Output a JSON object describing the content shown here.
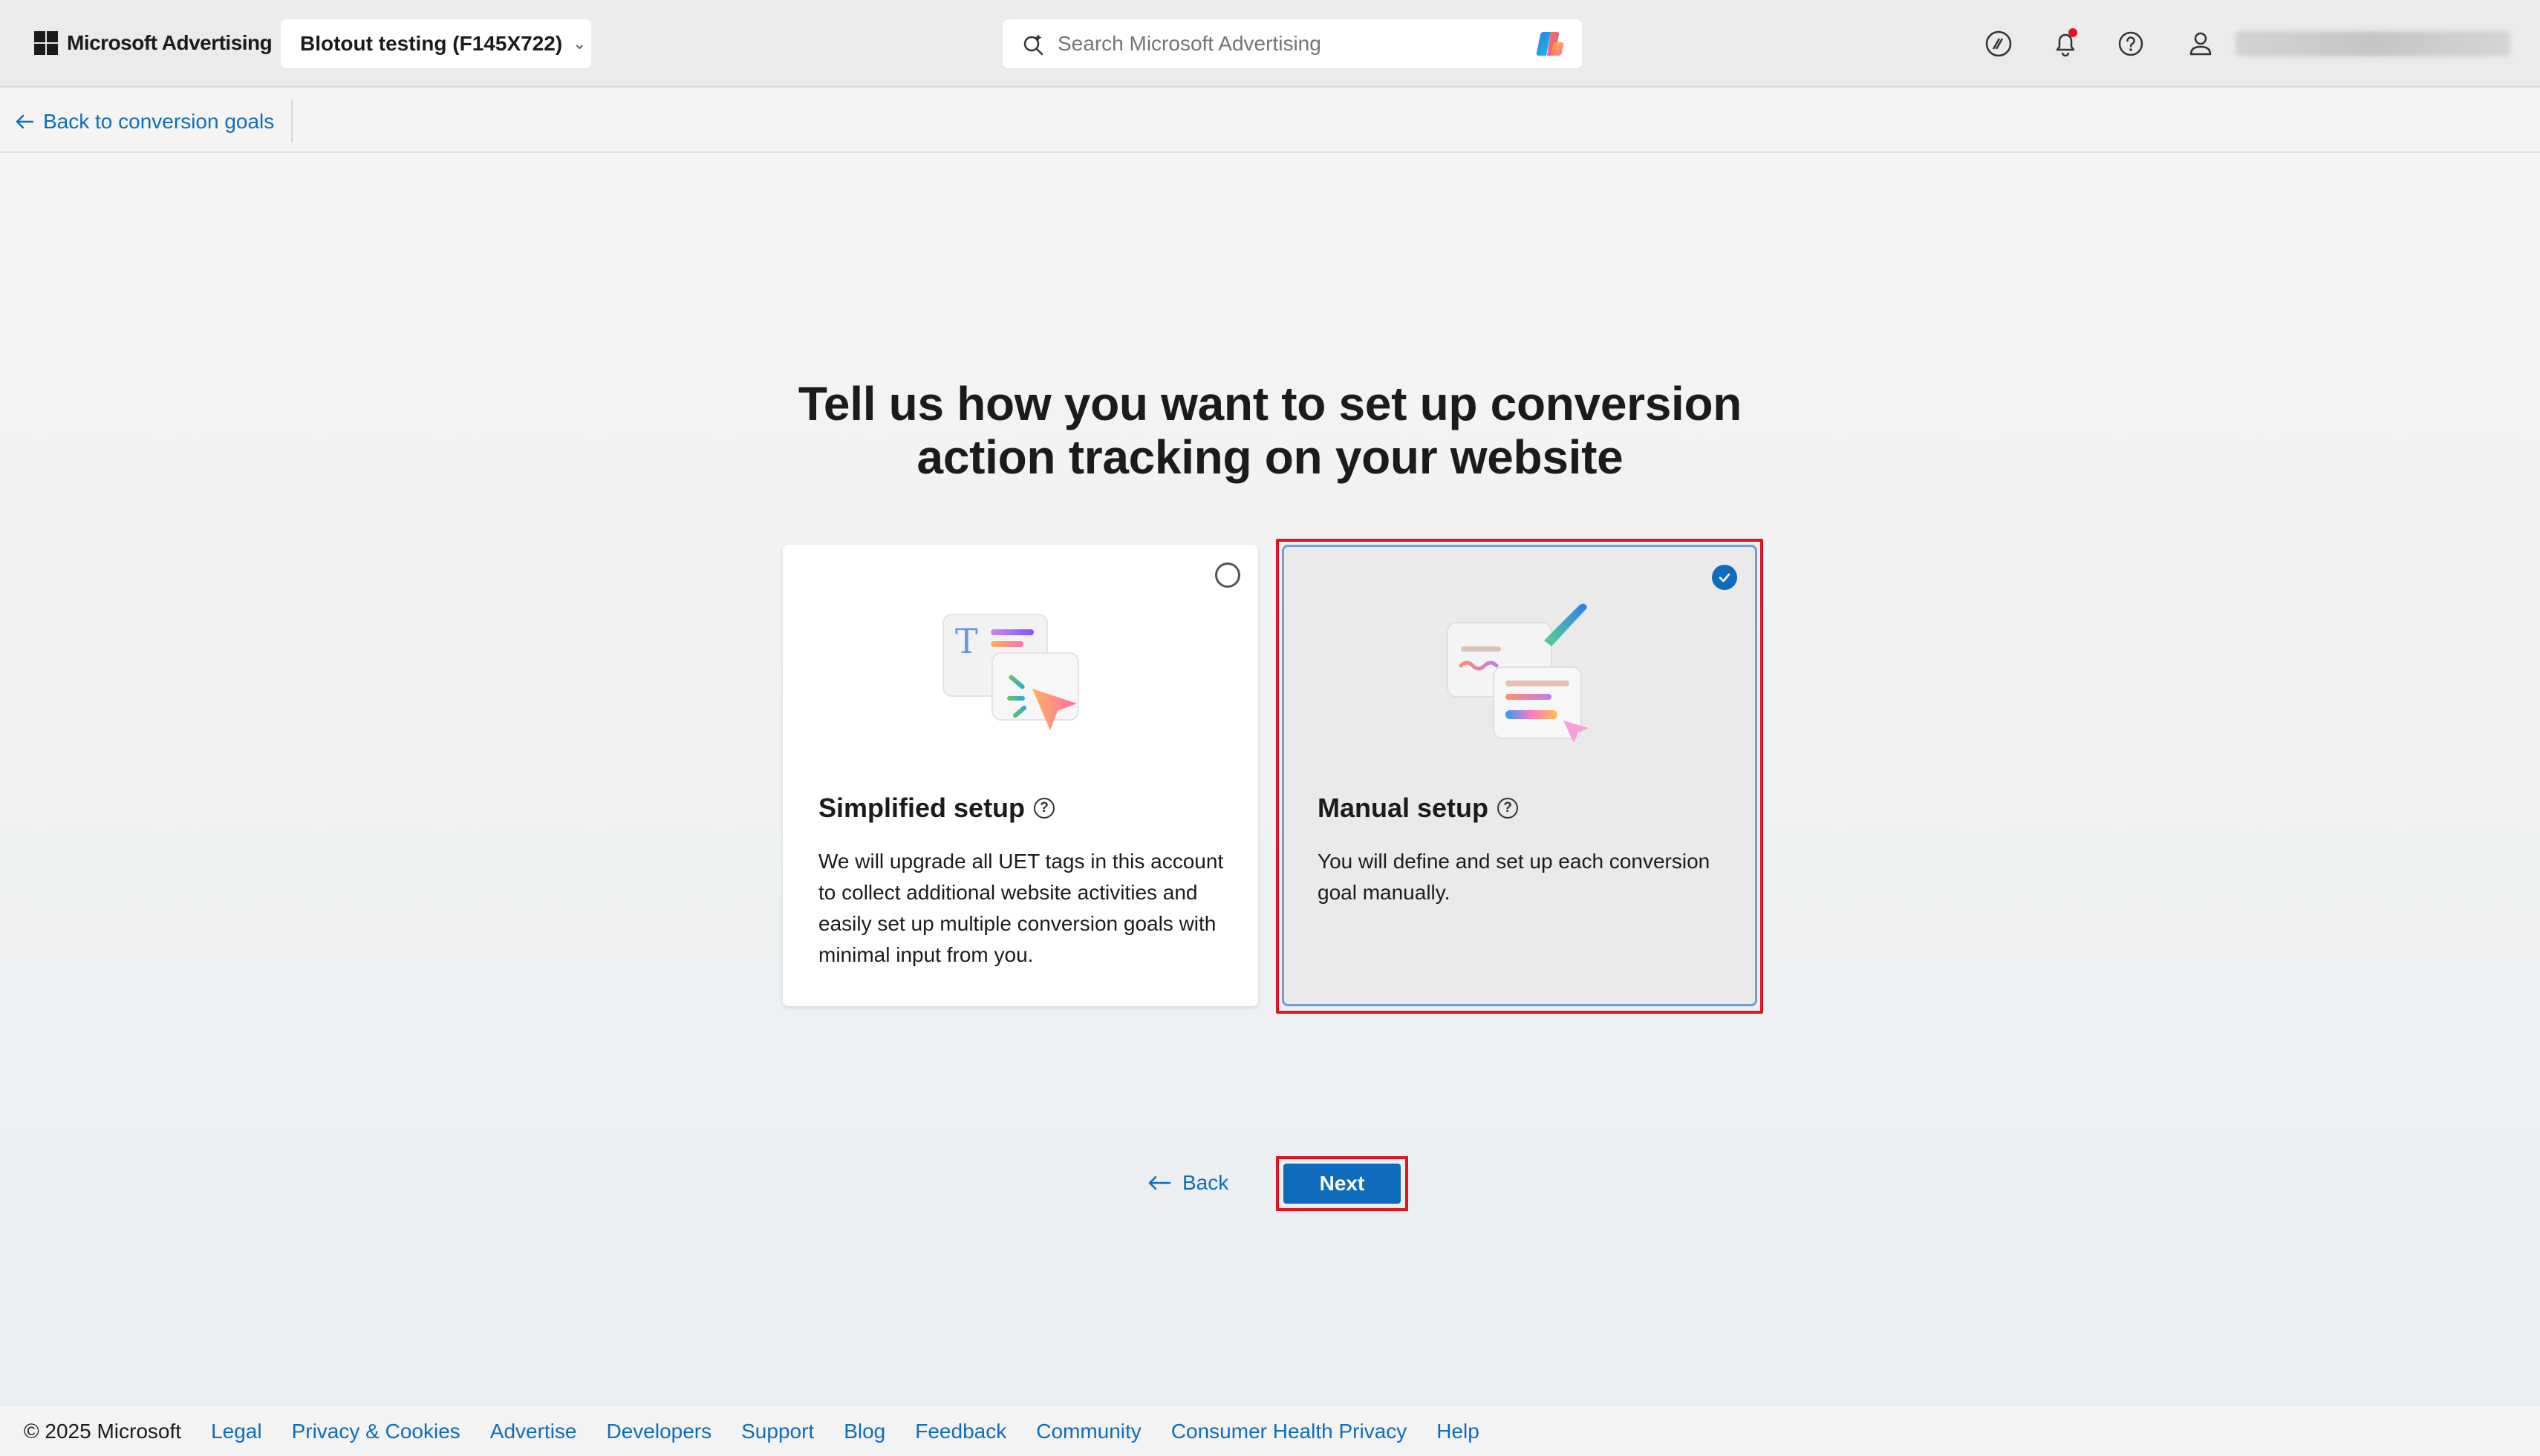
{
  "header": {
    "brand": "Microsoft Advertising",
    "account": "Blotout testing (F145X722)",
    "search_placeholder": "Search Microsoft Advertising",
    "icons": [
      "copilot-icon",
      "people-icon",
      "bell-icon",
      "help-icon",
      "profile-icon"
    ]
  },
  "subbar": {
    "back_label": "Back to conversion goals"
  },
  "main": {
    "heading_line1": "Tell us how you want to set up conversion",
    "heading_line2": "action tracking on your website",
    "options": [
      {
        "title": "Simplified setup",
        "description": "We will upgrade all UET tags in this account to collect additional website activities and easily set up multiple conversion goals with minimal input from you.",
        "selected": false
      },
      {
        "title": "Manual setup",
        "description": "You will define and set up each conversion goal manually.",
        "selected": true
      }
    ],
    "back_button": "Back",
    "next_button": "Next"
  },
  "footer": {
    "copyright": "© 2025 Microsoft",
    "links": [
      "Legal",
      "Privacy & Cookies",
      "Advertise",
      "Developers",
      "Support",
      "Blog",
      "Feedback",
      "Community",
      "Consumer Health Privacy",
      "Help"
    ]
  },
  "colors": {
    "accent": "#0f6cbd",
    "highlight": "#e0141e",
    "notification_dot": "#e81123"
  }
}
